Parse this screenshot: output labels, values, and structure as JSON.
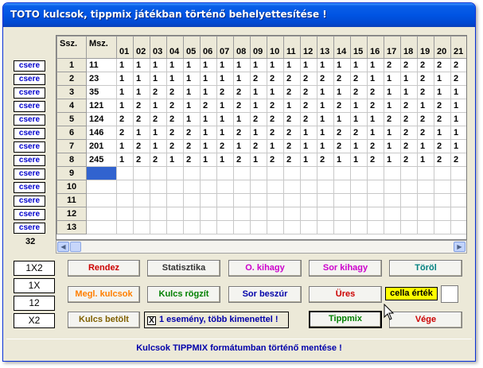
{
  "window": {
    "title": "TOTO kulcsok, tippmix játékban történő behelyettesítése !"
  },
  "left_panel": {
    "csere_label": "csere",
    "count": "32"
  },
  "grid": {
    "header": {
      "ssz": "Ssz.",
      "msz": "Msz."
    },
    "columns": [
      "01",
      "02",
      "03",
      "04",
      "05",
      "06",
      "07",
      "08",
      "09",
      "10",
      "11",
      "12",
      "13",
      "14",
      "15",
      "16",
      "17",
      "18",
      "19",
      "20",
      "21"
    ],
    "rows": [
      {
        "ssz": "1",
        "msz": "11",
        "vals": [
          "1",
          "1",
          "1",
          "1",
          "1",
          "1",
          "1",
          "1",
          "1",
          "1",
          "1",
          "1",
          "1",
          "1",
          "1",
          "1",
          "2",
          "2",
          "2",
          "2",
          "2"
        ]
      },
      {
        "ssz": "2",
        "msz": "23",
        "vals": [
          "1",
          "1",
          "1",
          "1",
          "1",
          "1",
          "1",
          "1",
          "2",
          "2",
          "2",
          "2",
          "2",
          "2",
          "2",
          "1",
          "1",
          "1",
          "2",
          "1",
          "2"
        ]
      },
      {
        "ssz": "3",
        "msz": "35",
        "vals": [
          "1",
          "1",
          "2",
          "2",
          "1",
          "1",
          "2",
          "2",
          "1",
          "1",
          "2",
          "2",
          "1",
          "1",
          "2",
          "2",
          "1",
          "1",
          "2",
          "1",
          "1"
        ]
      },
      {
        "ssz": "4",
        "msz": "121",
        "vals": [
          "1",
          "2",
          "1",
          "2",
          "1",
          "2",
          "1",
          "2",
          "1",
          "2",
          "1",
          "2",
          "1",
          "2",
          "1",
          "2",
          "1",
          "2",
          "1",
          "2",
          "1"
        ]
      },
      {
        "ssz": "5",
        "msz": "124",
        "vals": [
          "2",
          "2",
          "2",
          "2",
          "1",
          "1",
          "1",
          "1",
          "2",
          "2",
          "2",
          "2",
          "1",
          "1",
          "1",
          "1",
          "2",
          "2",
          "2",
          "2",
          "1"
        ]
      },
      {
        "ssz": "6",
        "msz": "146",
        "vals": [
          "2",
          "1",
          "1",
          "2",
          "2",
          "1",
          "1",
          "2",
          "1",
          "2",
          "2",
          "1",
          "1",
          "2",
          "2",
          "1",
          "1",
          "2",
          "2",
          "1",
          "1"
        ]
      },
      {
        "ssz": "7",
        "msz": "201",
        "vals": [
          "1",
          "2",
          "1",
          "2",
          "2",
          "1",
          "2",
          "1",
          "2",
          "1",
          "2",
          "1",
          "1",
          "2",
          "1",
          "2",
          "1",
          "2",
          "1",
          "2",
          "1"
        ]
      },
      {
        "ssz": "8",
        "msz": "245",
        "vals": [
          "1",
          "2",
          "2",
          "1",
          "2",
          "1",
          "1",
          "2",
          "1",
          "2",
          "2",
          "1",
          "2",
          "1",
          "1",
          "2",
          "1",
          "2",
          "1",
          "2",
          "2"
        ]
      },
      {
        "ssz": "9",
        "msz": "",
        "vals": []
      },
      {
        "ssz": "10",
        "msz": "",
        "vals": []
      },
      {
        "ssz": "11",
        "msz": "",
        "vals": []
      },
      {
        "ssz": "12",
        "msz": "",
        "vals": []
      },
      {
        "ssz": "13",
        "msz": "",
        "vals": []
      }
    ]
  },
  "buttons": {
    "b_1x2": "1X2",
    "b_1x": "1X",
    "b_12": "12",
    "b_x2": "X2",
    "rendez": "Rendez",
    "statisztika": "Statisztika",
    "o_kihagy": "O. kihagy",
    "sor_kihagy": "Sor kihagy",
    "torol": "Töröl",
    "megl_kulcsok": "Megl. kulcsok",
    "kulcs_rogzit": "Kulcs rögzít",
    "sor_beszur": "Sor beszúr",
    "ures": "Üres",
    "kulcs_betolt": "Kulcs betölt",
    "tippmix": "Tippmix",
    "vege": "Vége"
  },
  "checkbox": {
    "label": "1 esemény, több kimenettel !",
    "mark": "X",
    "checked": true
  },
  "cella_label": "cella érték",
  "status_text": "Kulcsok TIPPMIX formátumban történő mentése !",
  "colors": {
    "rendez": "#cc0000",
    "statisztika": "#333333",
    "o_kihagy": "#cc00cc",
    "sor_kihagy": "#cc00cc",
    "torol": "#008080",
    "megl_kulcsok": "#ff7f00",
    "kulcs_rogzit": "#008000",
    "sor_beszur": "#0000aa",
    "ures": "#cc0000",
    "kulcs_betolt": "#806000",
    "tippmix": "#008000",
    "vege": "#cc0000",
    "selection": "#3163cf"
  }
}
